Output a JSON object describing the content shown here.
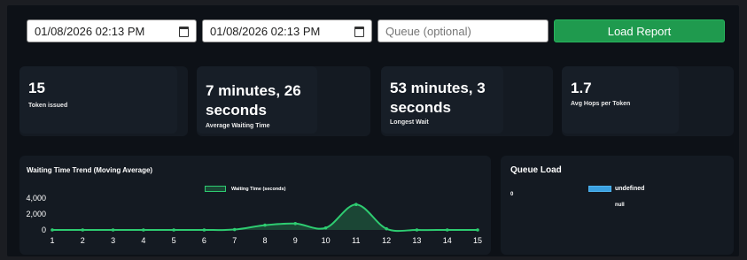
{
  "filters": {
    "start_date": "01/08/2026 02:13 PM",
    "end_date": "01/08/2026 02:13 PM",
    "queue_placeholder": "Queue (optional)",
    "load_label": "Load Report"
  },
  "stats": [
    {
      "value_lines": [
        "15"
      ],
      "label": "Token issued"
    },
    {
      "value_lines": [
        "7 minutes, 26",
        "seconds"
      ],
      "label": "Average Waiting Time"
    },
    {
      "value_lines": [
        "53 minutes, 3",
        "seconds"
      ],
      "label": "Longest Wait"
    },
    {
      "value_lines": [
        "1.7"
      ],
      "label": "Avg Hops per Token"
    }
  ],
  "trend": {
    "title": "Waiting Time Trend (Moving Average)"
  },
  "queue_load": {
    "title": "Queue Load",
    "axis_tick": "0",
    "legend": "undefined",
    "category": "null"
  },
  "chart_data": [
    {
      "type": "line",
      "title": "Waiting Time Trend (Moving Average)",
      "x": [
        1,
        2,
        3,
        4,
        5,
        6,
        7,
        8,
        9,
        10,
        11,
        12,
        13,
        14,
        15
      ],
      "series": [
        {
          "name": "Waiting Time (seconds)",
          "values": [
            0,
            0,
            0,
            0,
            0,
            0,
            50,
            600,
            800,
            250,
            3200,
            150,
            0,
            0,
            0
          ]
        }
      ],
      "y_ticks": [
        "4,000",
        "2,000",
        "0"
      ],
      "ylim": [
        0,
        4000
      ],
      "grid": false,
      "legend_position": "top",
      "colors": {
        "line": "#2ecc71",
        "fill": "rgba(46,204,113,0.25)"
      }
    },
    {
      "type": "bar",
      "title": "Queue Load",
      "categories": [
        "null"
      ],
      "series": [
        {
          "name": "undefined",
          "values": [
            0
          ]
        }
      ],
      "legend_position": "top",
      "colors": {
        "bar": "#3aa0e0"
      }
    }
  ]
}
